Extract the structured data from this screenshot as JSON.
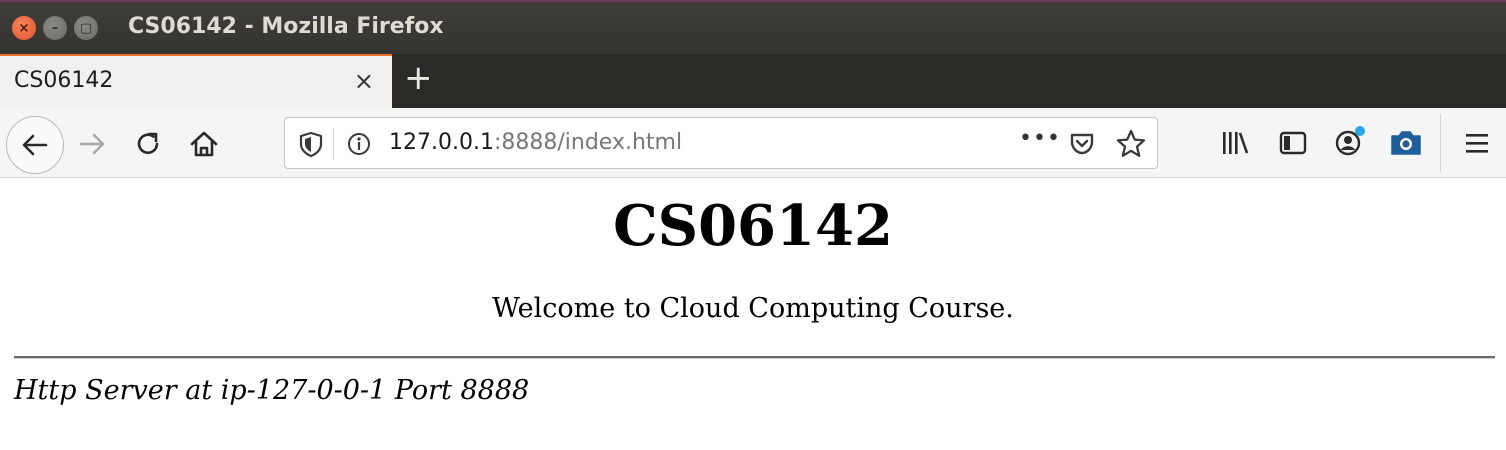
{
  "window": {
    "title": "CS06142 - Mozilla Firefox",
    "close_glyph": "×",
    "min_glyph": "–",
    "max_glyph": "▢"
  },
  "tabs": [
    {
      "title": "CS06142",
      "close_glyph": "×",
      "active": true
    }
  ],
  "new_tab_glyph": "+",
  "navbar": {
    "url_host": "127.0.0.1",
    "url_rest": ":8888/index.html",
    "more_glyph": "•••",
    "icons": [
      "back-arrow-icon",
      "forward-arrow-icon",
      "reload-icon",
      "home-icon",
      "shield-icon",
      "info-icon",
      "pocket-icon",
      "star-icon",
      "library-icon",
      "sidebar-icon",
      "account-icon",
      "screenshot-icon",
      "hamburger-menu-icon"
    ]
  },
  "page": {
    "heading": "CS06142",
    "welcome": "Welcome to Cloud Computing Course.",
    "footer": "Http Server at ip-127-0-0-1 Port 8888"
  },
  "colors": {
    "titlebar": "#3e3d39",
    "tabstrip": "#2b2a26",
    "active_tab_accent": "#e8742c",
    "close_button": "#e2552a",
    "account_badge": "#2aa6e8"
  }
}
